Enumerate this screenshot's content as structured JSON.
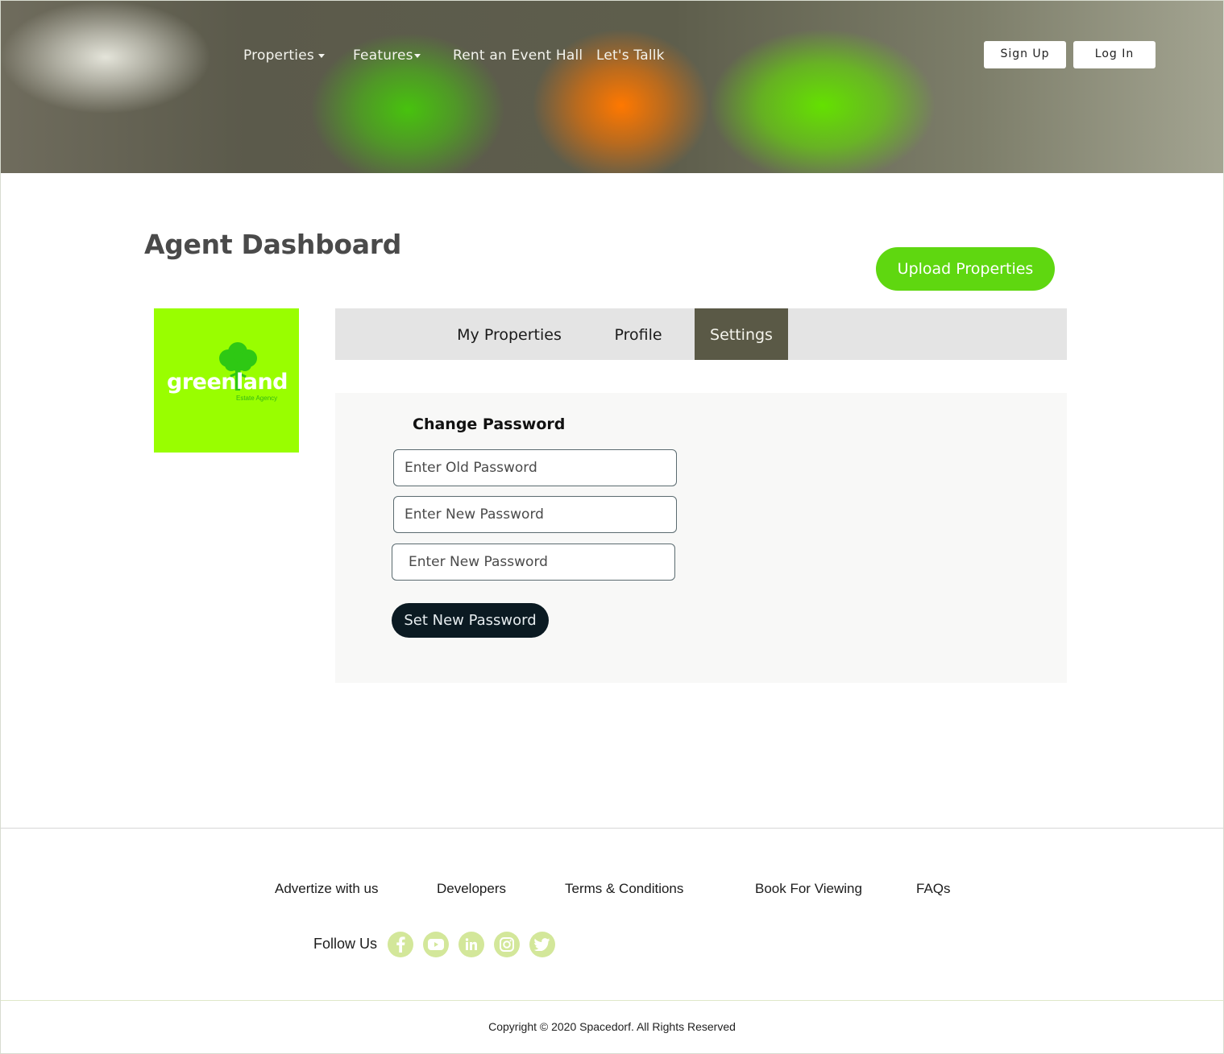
{
  "nav": {
    "items": [
      {
        "label": "Properties",
        "has_dropdown": true
      },
      {
        "label": "Features",
        "has_dropdown": true
      },
      {
        "label": "Rent an Event Hall",
        "has_dropdown": false
      },
      {
        "label": "Let's Tallk",
        "has_dropdown": false
      }
    ],
    "signup_label": "Sign Up",
    "login_label": "Log In"
  },
  "main": {
    "title": "Agent Dashboard",
    "upload_label": "Upload Properties",
    "logo": {
      "text": "greenland",
      "subtext": "Estate Agency"
    },
    "tabs": [
      {
        "label": "My Properties",
        "active": false
      },
      {
        "label": "Profile",
        "active": false
      },
      {
        "label": "Settings",
        "active": true
      }
    ],
    "change_password": {
      "title": "Change Password",
      "old_placeholder": "Enter Old Password",
      "new_placeholder": "Enter New Password",
      "confirm_placeholder": "Enter New Password",
      "submit_label": "Set New Password"
    }
  },
  "footer": {
    "links": [
      "Advertize with us",
      "Developers",
      "Terms & Conditions",
      "Book For Viewing",
      "FAQs"
    ],
    "follow_label": "Follow Us",
    "socials": [
      "facebook-icon",
      "youtube-icon",
      "linkedin-icon",
      "instagram-icon",
      "twitter-icon"
    ],
    "copyright": "Copyright © 2020 Spacedorf. All Rights Reserved"
  },
  "colors": {
    "accent_green": "#5fd710",
    "logo_bg": "#99fe00",
    "active_tab": "#5a5946",
    "dark_button": "#0b1a22",
    "social_bg": "#d3e79a"
  }
}
